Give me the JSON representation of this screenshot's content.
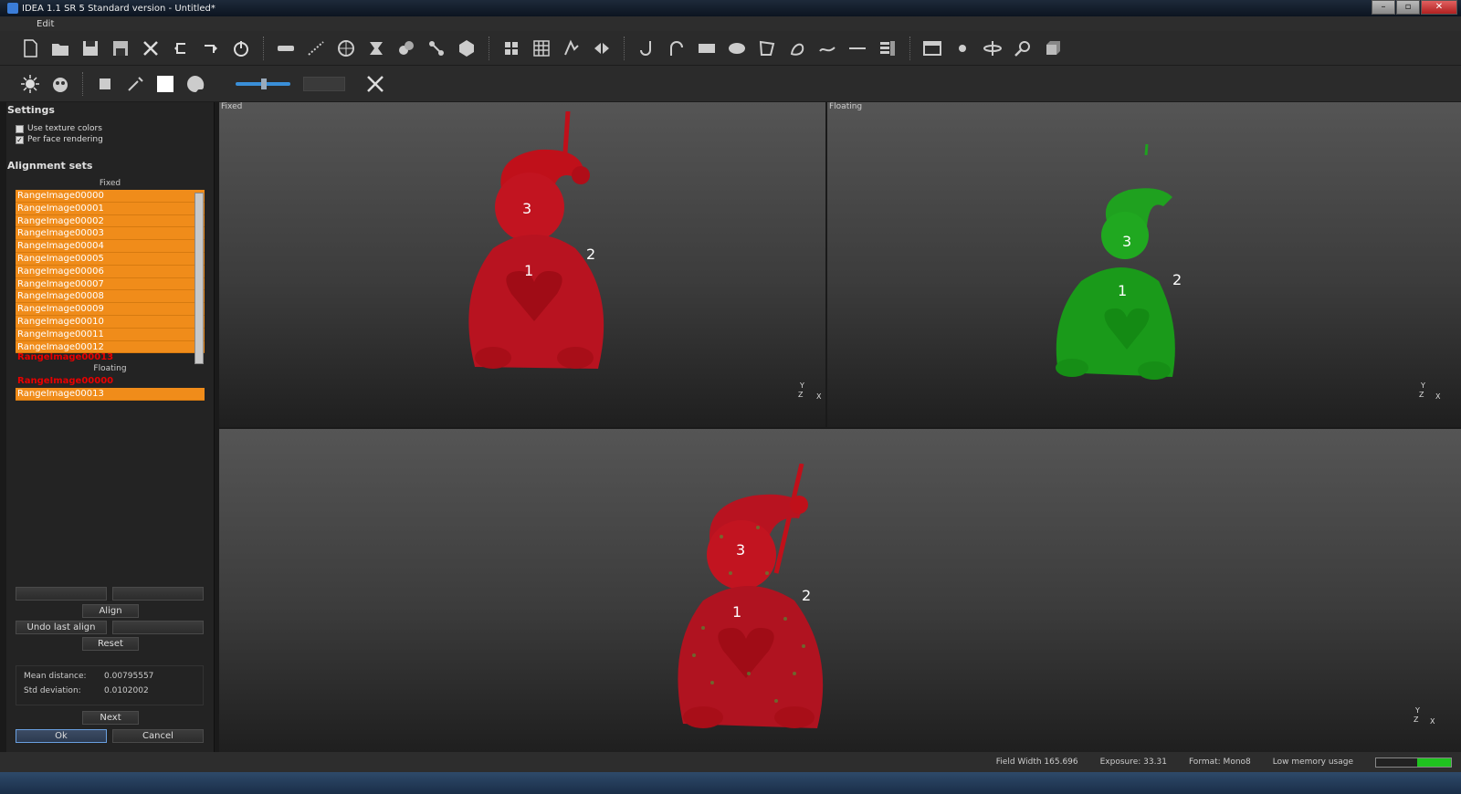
{
  "window": {
    "title": "IDEA 1.1 SR 5 Standard version - Untitled*"
  },
  "menu": [
    "Edit"
  ],
  "settings": {
    "title": "Settings",
    "use_texture_colors": "Use texture colors",
    "per_face_rendering": "Per face rendering"
  },
  "alignment": {
    "title": "Alignment sets",
    "fixed_label": "Fixed",
    "fixed_items": [
      "RangeImage00000",
      "RangeImage00001",
      "RangeImage00002",
      "RangeImage00003",
      "RangeImage00004",
      "RangeImage00005",
      "RangeImage00006",
      "RangeImage00007",
      "RangeImage00008",
      "RangeImage00009",
      "RangeImage00010",
      "RangeImage00011",
      "RangeImage00012",
      "RangeImage00013"
    ],
    "floating_label": "Floating",
    "floating_items": [
      "RangeImage00000",
      "RangeImage00013"
    ]
  },
  "buttons": {
    "align": "Align",
    "undo_last_align": "Undo last align",
    "reset": "Reset",
    "next": "Next",
    "ok": "Ok",
    "cancel": "Cancel"
  },
  "stats": {
    "mean_label": "Mean distance:",
    "mean_value": "0.00795557",
    "std_label": "Std deviation:",
    "std_value": "0.0102002"
  },
  "viewports": {
    "fixed_label": "Fixed",
    "floating_label": "Floating",
    "markers": [
      "1",
      "2",
      "3"
    ],
    "axes": {
      "y": "Y",
      "z": "Z",
      "x": "X"
    }
  },
  "statusbar": {
    "field_width": "Field Width 165.696",
    "exposure": "Exposure: 33.31",
    "format": "Format: Mono8",
    "memory": "Low memory usage",
    "memory_fraction": 0.45
  },
  "colors": {
    "selection": "#f08c1a",
    "fixed_model": "#c0101a",
    "floating_model": "#1fa11f"
  }
}
